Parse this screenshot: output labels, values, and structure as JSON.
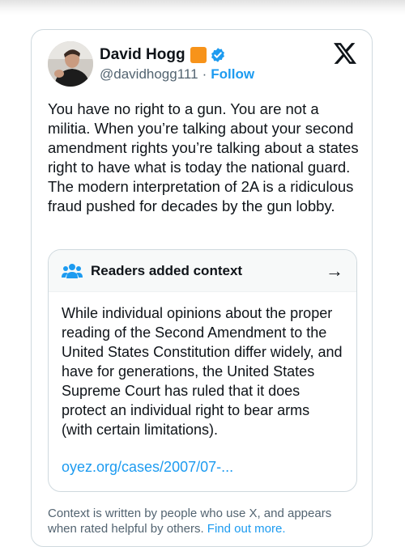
{
  "author": {
    "display_name": "David Hogg",
    "handle": "@davidhogg111",
    "separator": "·",
    "follow_label": "Follow"
  },
  "tweet": {
    "text": "You have no right to a gun. You are not a militia. When you’re talking about your second amendment rights you’re talking about a states right to have what is today the national guard. The modern interpretation of 2A is a ridiculous fraud pushed for decades by the gun lobby."
  },
  "context_note": {
    "title": "Readers added context",
    "arrow": "→",
    "body": "While individual opinions about the proper reading of the Second Amendment to the United States Constitution differ widely, and have for generations, the United States Supreme Court has ruled that it does protect an individual right to bear arms (with certain limitations).",
    "link_text": "oyez.org/cases/2007/07-..."
  },
  "footnote": {
    "text": "Context is written by people who use X, and appears when rated helpful by others. ",
    "link": "Find out more."
  },
  "colors": {
    "accent": "#1d9bf0",
    "affiliation_badge": "#f7931a",
    "secondary_text": "#536471"
  },
  "icons": [
    "avatar",
    "affiliation-badge-icon",
    "verified-badge-icon",
    "x-logo-icon",
    "people-icon",
    "arrow-right-icon"
  ]
}
